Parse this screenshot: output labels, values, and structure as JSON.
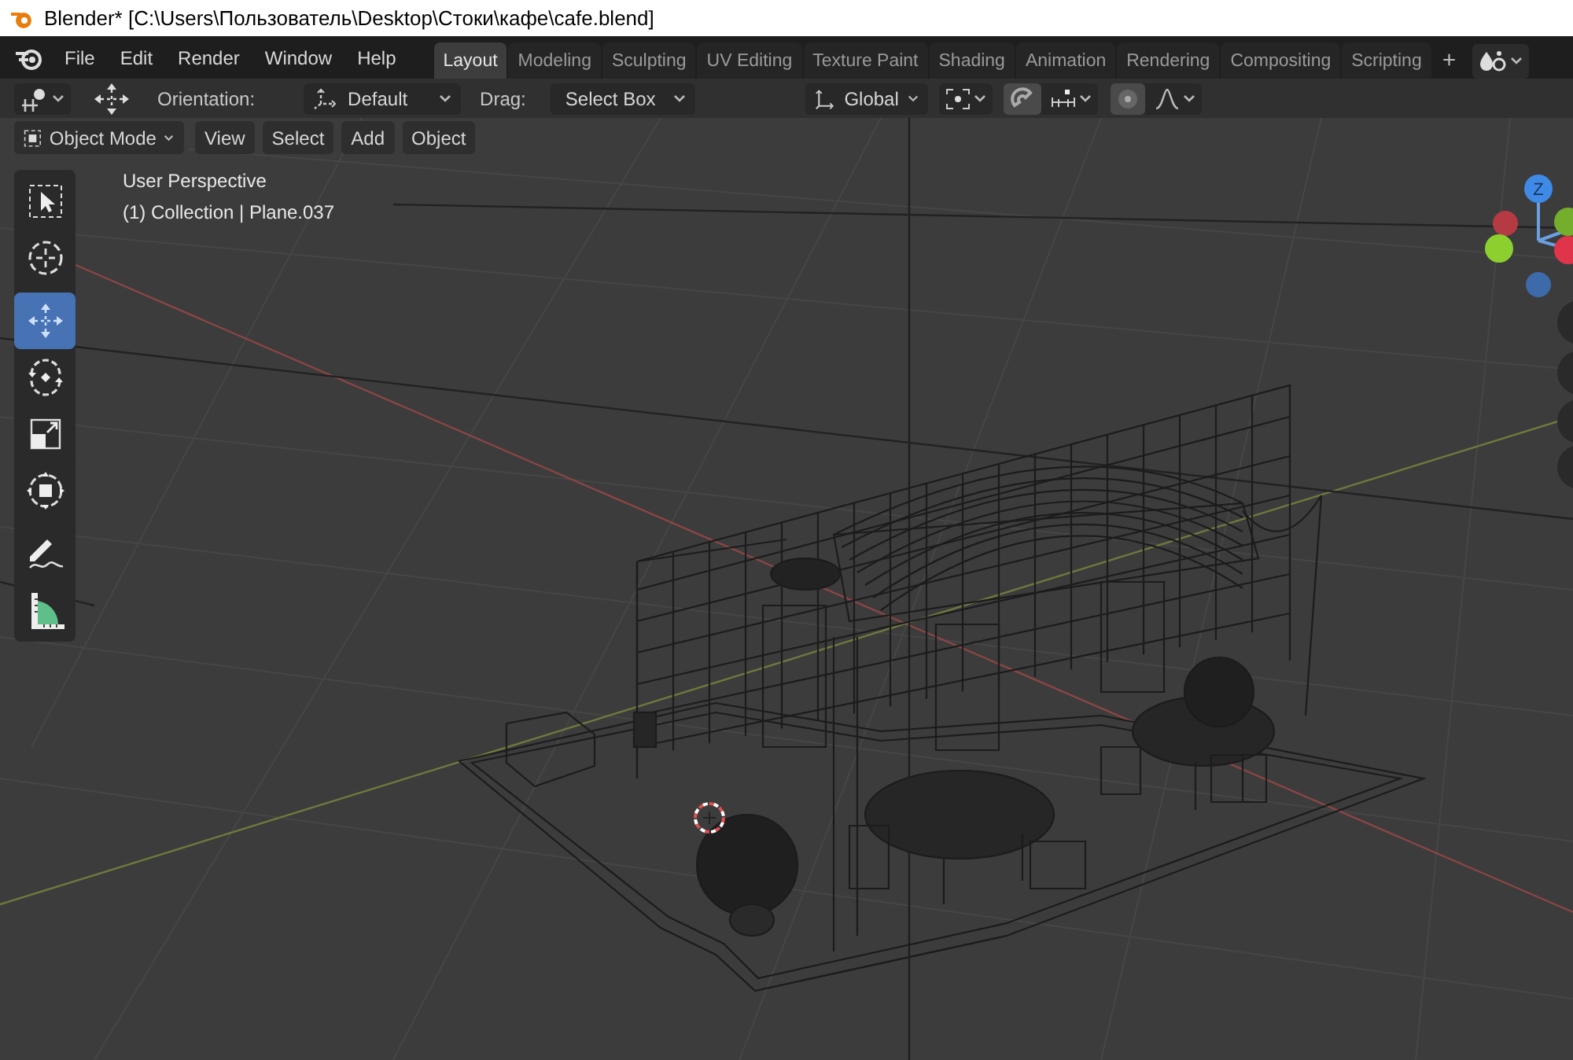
{
  "window": {
    "title": "Blender* [C:\\Users\\Пользователь\\Desktop\\Стоки\\кафе\\cafe.blend]"
  },
  "menu": [
    "File",
    "Edit",
    "Render",
    "Window",
    "Help"
  ],
  "workspaces": [
    {
      "label": "Layout",
      "selected": true
    },
    {
      "label": "Modeling",
      "selected": false
    },
    {
      "label": "Sculpting",
      "selected": false
    },
    {
      "label": "UV Editing",
      "selected": false
    },
    {
      "label": "Texture Paint",
      "selected": false
    },
    {
      "label": "Shading",
      "selected": false
    },
    {
      "label": "Animation",
      "selected": false
    },
    {
      "label": "Rendering",
      "selected": false
    },
    {
      "label": "Compositing",
      "selected": false
    },
    {
      "label": "Scripting",
      "selected": false
    }
  ],
  "add_workspace": "+",
  "tool_header": {
    "orientation_label": "Orientation:",
    "orientation": "Default",
    "drag_label": "Drag:",
    "drag": "Select Box",
    "transform_orientation": "Global"
  },
  "viewport_header": {
    "mode": "Object Mode",
    "menus": [
      "View",
      "Select",
      "Add",
      "Object"
    ]
  },
  "overlay": {
    "view_name": "User Perspective",
    "object_info": "(1) Collection | Plane.037"
  },
  "toolbar": [
    {
      "kind": "select_box",
      "selected": false
    },
    {
      "kind": "cursor",
      "selected": false
    },
    {
      "kind": "move",
      "selected": true
    },
    {
      "kind": "rotate",
      "selected": false
    },
    {
      "kind": "scale",
      "selected": false
    },
    {
      "kind": "transform",
      "selected": false
    },
    {
      "kind": "annotate",
      "selected": false
    },
    {
      "kind": "measure",
      "selected": false
    }
  ],
  "gizmo": {
    "z_label": "Z"
  }
}
